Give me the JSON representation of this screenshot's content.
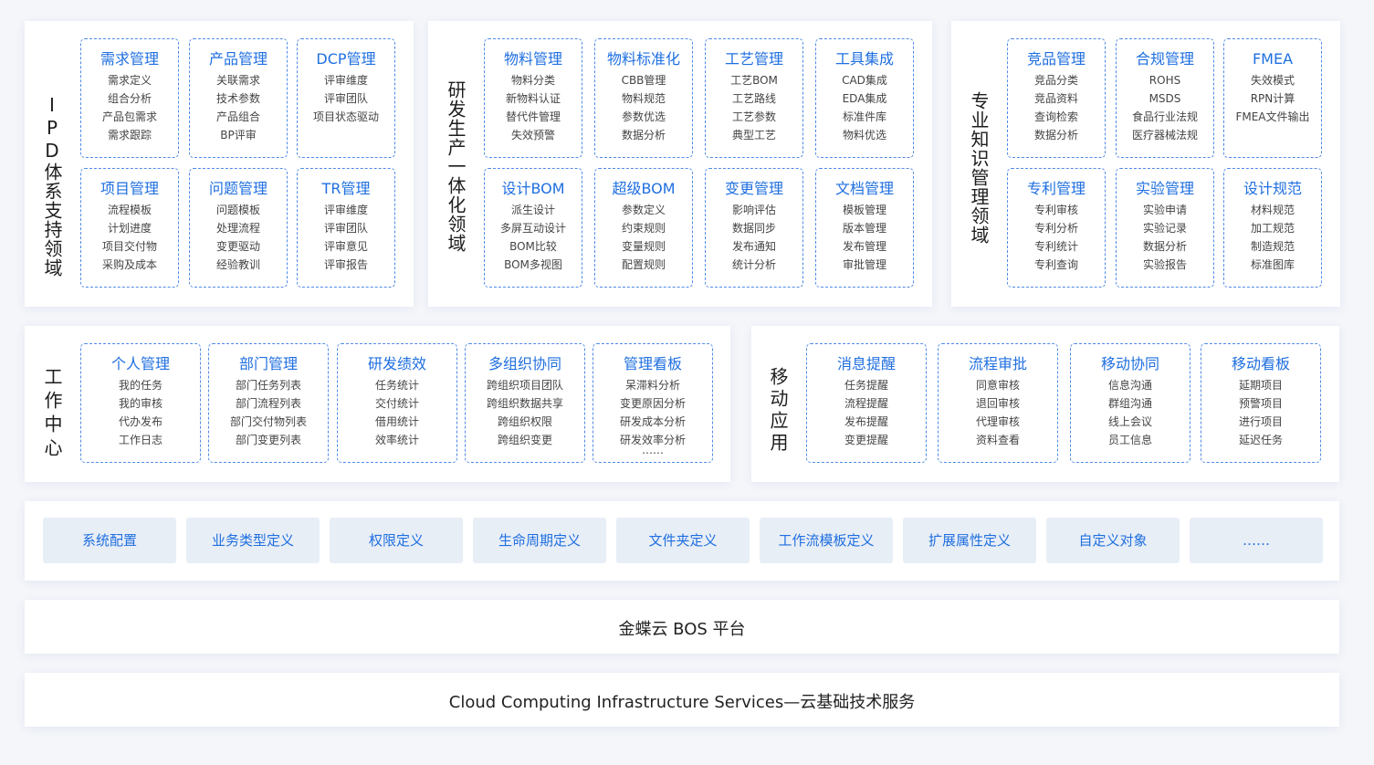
{
  "domains": {
    "ipd": "IPD体系支持领域",
    "rnd": "研发生产一体化领域",
    "knowledge": "专业知识管理领域",
    "work": "工作中心",
    "mobile": "移动应用"
  },
  "cards": {
    "demand": {
      "title": "需求管理",
      "items": [
        "需求定义",
        "组合分析",
        "产品包需求",
        "需求跟踪"
      ]
    },
    "product": {
      "title": "产品管理",
      "items": [
        "关联需求",
        "技术参数",
        "产品组合",
        "BP评审"
      ]
    },
    "dcp": {
      "title": "DCP管理",
      "items": [
        "评审维度",
        "评审团队",
        "项目状态驱动"
      ]
    },
    "project": {
      "title": "项目管理",
      "items": [
        "流程模板",
        "计划进度",
        "项目交付物",
        "采购及成本"
      ]
    },
    "issue": {
      "title": "问题管理",
      "items": [
        "问题模板",
        "处理流程",
        "变更驱动",
        "经验教训"
      ]
    },
    "tr": {
      "title": "TR管理",
      "items": [
        "评审维度",
        "评审团队",
        "评审意见",
        "评审报告"
      ]
    },
    "material": {
      "title": "物料管理",
      "items": [
        "物料分类",
        "新物料认证",
        "替代件管理",
        "失效预警"
      ]
    },
    "standard": {
      "title": "物料标准化",
      "items": [
        "CBB管理",
        "物料规范",
        "参数优选",
        "数据分析"
      ]
    },
    "process": {
      "title": "工艺管理",
      "items": [
        "工艺BOM",
        "工艺路线",
        "工艺参数",
        "典型工艺"
      ]
    },
    "tools": {
      "title": "工具集成",
      "items": [
        "CAD集成",
        "EDA集成",
        "标准件库",
        "物料优选"
      ]
    },
    "dbom": {
      "title": "设计BOM",
      "items": [
        "派生设计",
        "多屏互动设计",
        "BOM比较",
        "BOM多视图"
      ]
    },
    "sbom": {
      "title": "超级BOM",
      "items": [
        "参数定义",
        "约束规则",
        "变量规则",
        "配置规则"
      ]
    },
    "change": {
      "title": "变更管理",
      "items": [
        "影响评估",
        "数据同步",
        "发布通知",
        "统计分析"
      ]
    },
    "doc": {
      "title": "文档管理",
      "items": [
        "模板管理",
        "版本管理",
        "发布管理",
        "审批管理"
      ]
    },
    "compete": {
      "title": "竞品管理",
      "items": [
        "竞品分类",
        "竞品资料",
        "查询检索",
        "数据分析"
      ]
    },
    "compliance": {
      "title": "合规管理",
      "items": [
        "ROHS",
        "MSDS",
        "食品行业法规",
        "医疗器械法规"
      ]
    },
    "fmea": {
      "title": "FMEA",
      "items": [
        "失效模式",
        "RPN计算",
        "FMEA文件输出"
      ]
    },
    "patent": {
      "title": "专利管理",
      "items": [
        "专利审核",
        "专利分析",
        "专利统计",
        "专利查询"
      ]
    },
    "lab": {
      "title": "实验管理",
      "items": [
        "实验申请",
        "实验记录",
        "数据分析",
        "实验报告"
      ]
    },
    "spec": {
      "title": "设计规范",
      "items": [
        "材料规范",
        "加工规范",
        "制造规范",
        "标准图库"
      ]
    },
    "personal": {
      "title": "个人管理",
      "items": [
        "我的任务",
        "我的审核",
        "代办发布",
        "工作日志"
      ]
    },
    "dept": {
      "title": "部门管理",
      "items": [
        "部门任务列表",
        "部门流程列表",
        "部门交付物列表",
        "部门变更列表"
      ]
    },
    "perf": {
      "title": "研发绩效",
      "items": [
        "任务统计",
        "交付统计",
        "借用统计",
        "效率统计"
      ]
    },
    "multiorg": {
      "title": "多组织协同",
      "items": [
        "跨组织项目团队",
        "跨组织数据共享",
        "跨组织权限",
        "跨组织变更"
      ]
    },
    "board": {
      "title": "管理看板",
      "items": [
        "呆滞料分析",
        "变更原因分析",
        "研发成本分析",
        "研发效率分析",
        "……"
      ]
    },
    "msg": {
      "title": "消息提醒",
      "items": [
        "任务提醒",
        "流程提醒",
        "发布提醒",
        "变更提醒"
      ]
    },
    "flow": {
      "title": "流程审批",
      "items": [
        "同意审核",
        "退回审核",
        "代理审核",
        "资料查看"
      ]
    },
    "mcoop": {
      "title": "移动协同",
      "items": [
        "信息沟通",
        "群组沟通",
        "线上会议",
        "员工信息"
      ]
    },
    "mboard": {
      "title": "移动看板",
      "items": [
        "延期项目",
        "预警项目",
        "进行项目",
        "延迟任务"
      ]
    }
  },
  "platform_items": [
    "系统配置",
    "业务类型定义",
    "权限定义",
    "生命周期定义",
    "文件夹定义",
    "工作流模板定义",
    "扩展属性定义",
    "自定义对象",
    "……"
  ],
  "bos_platform": "金蝶云 BOS 平台",
  "cloud_services": "Cloud Computing Infrastructure Services—云基础技术服务",
  "colors": {
    "accent": "#1f6fe0",
    "card_border": "#4f8ae8",
    "chip_bg": "#e8eef6",
    "page_bg": "#f4f6fa"
  }
}
